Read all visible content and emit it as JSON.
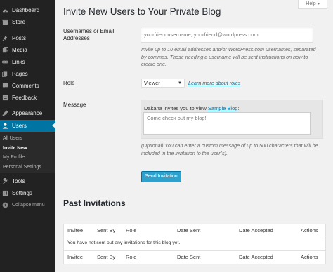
{
  "sidebar": {
    "items": [
      {
        "label": "Dashboard",
        "icon": "dashboard-icon"
      },
      {
        "label": "Store",
        "icon": "store-icon"
      },
      {
        "label": "Posts",
        "icon": "pin-icon"
      },
      {
        "label": "Media",
        "icon": "media-icon"
      },
      {
        "label": "Links",
        "icon": "links-icon"
      },
      {
        "label": "Pages",
        "icon": "pages-icon"
      },
      {
        "label": "Comments",
        "icon": "comments-icon"
      },
      {
        "label": "Feedback",
        "icon": "feedback-icon"
      },
      {
        "label": "Appearance",
        "icon": "appearance-icon"
      },
      {
        "label": "Users",
        "icon": "users-icon"
      },
      {
        "label": "Tools",
        "icon": "tools-icon"
      },
      {
        "label": "Settings",
        "icon": "settings-icon"
      },
      {
        "label": "Collapse menu",
        "icon": "collapse-icon"
      }
    ],
    "users_submenu": [
      "All Users",
      "Invite New",
      "My Profile",
      "Personal Settings"
    ],
    "current_item": "Users",
    "current_sub": "Invite New",
    "colors": {
      "background": "#222222",
      "current": "#0074a2"
    }
  },
  "help_tab": {
    "label": "Help"
  },
  "page_title": "Invite New Users to Your Private Blog",
  "form": {
    "usernames": {
      "label": "Usernames or Email Addresses",
      "placeholder": "yourfriendusername, yourfriend@wordpress.com",
      "description": "Invite up to 10 email addresses and/or WordPress.com usernames, separated by commas. Those needing a username will be sent instructions on how to create one."
    },
    "role": {
      "label": "Role",
      "selected": "Viewer",
      "link": "Learn more about roles"
    },
    "message": {
      "label": "Message",
      "prefix": "Dakana invites you to view",
      "blog_link": "Sample Blog",
      "suffix": ":",
      "placeholder": "Come check out my blog!",
      "description": "(Optional) You can enter a custom message of up to 500 characters that will be included in the invitation to the user(s)."
    },
    "send_label": "Send Invitation",
    "accent_color": "#2ea2cc"
  },
  "past_invitations": {
    "title": "Past Invitations",
    "columns": [
      "Invitee",
      "Sent By",
      "Role",
      "Date Sent",
      "Date Accepted",
      "Actions"
    ],
    "empty_message": "You have not sent out any invitations for this blog yet."
  }
}
